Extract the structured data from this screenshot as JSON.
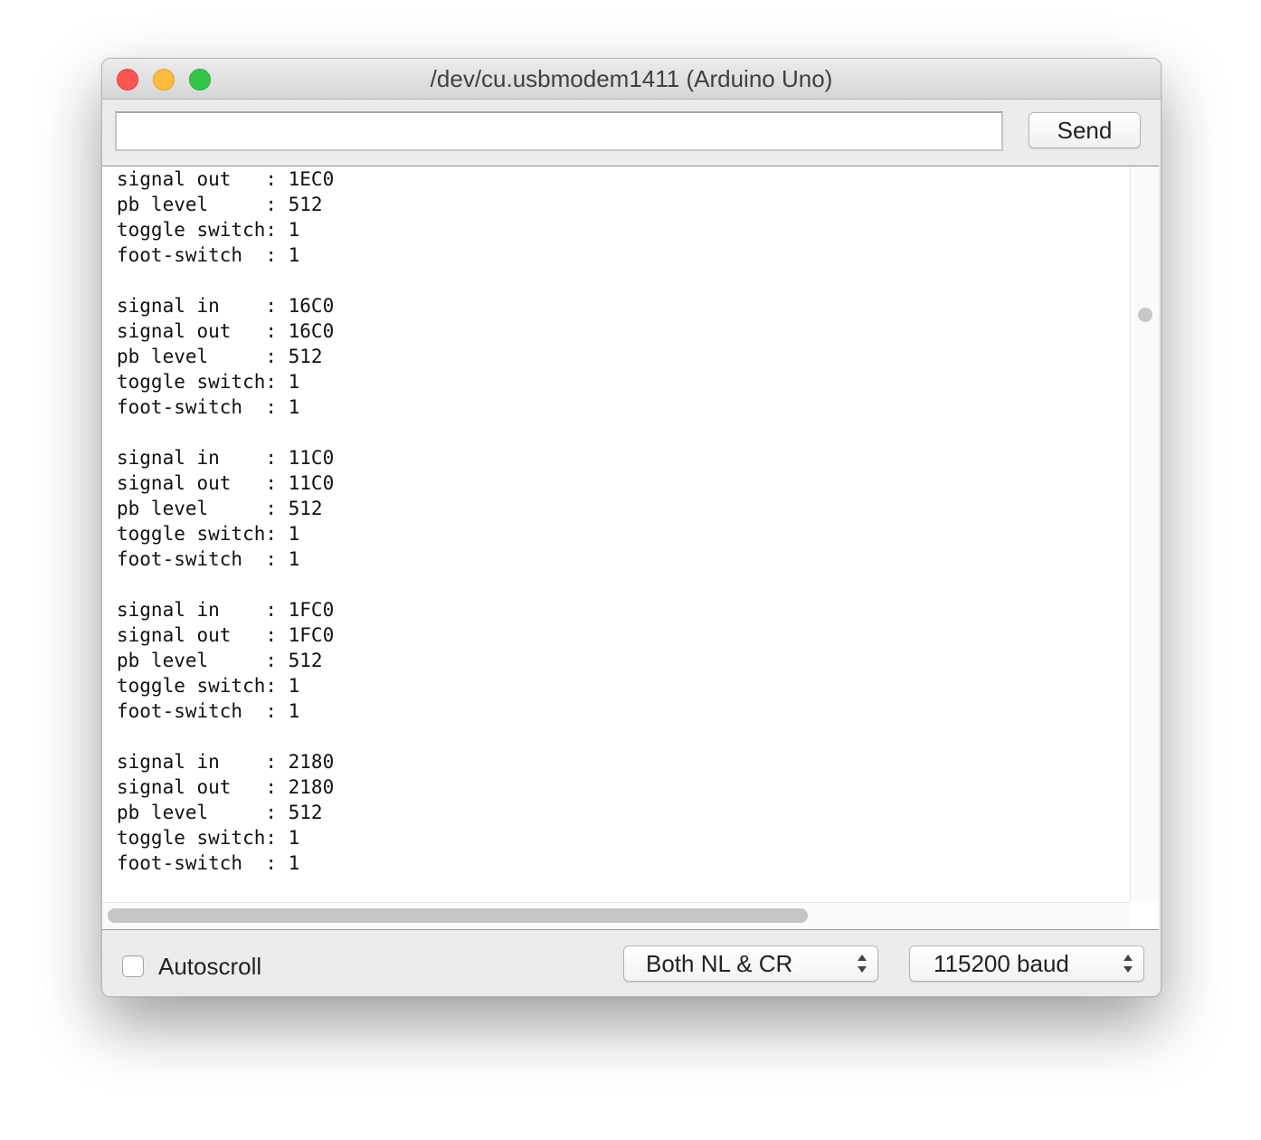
{
  "window": {
    "title": "/dev/cu.usbmodem1411 (Arduino Uno)"
  },
  "input": {
    "value": "",
    "placeholder": ""
  },
  "send_button": {
    "label": "Send"
  },
  "output_lines": [
    "signal out   : 1EC0",
    "pb level     : 512",
    "toggle switch: 1",
    "foot-switch  : 1",
    "",
    "signal in    : 16C0",
    "signal out   : 16C0",
    "pb level     : 512",
    "toggle switch: 1",
    "foot-switch  : 1",
    "",
    "signal in    : 11C0",
    "signal out   : 11C0",
    "pb level     : 512",
    "toggle switch: 1",
    "foot-switch  : 1",
    "",
    "signal in    : 1FC0",
    "signal out   : 1FC0",
    "pb level     : 512",
    "toggle switch: 1",
    "foot-switch  : 1",
    "",
    "signal in    : 2180",
    "signal out   : 2180",
    "pb level     : 512",
    "toggle switch: 1",
    "foot-switch  : 1"
  ],
  "footer": {
    "autoscroll_label": "Autoscroll",
    "autoscroll_checked": false,
    "line_ending": "Both NL & CR",
    "baud_rate": "115200 baud"
  },
  "colors": {
    "close": "#fc5753",
    "minimize": "#fdbc40",
    "maximize": "#33c748"
  }
}
